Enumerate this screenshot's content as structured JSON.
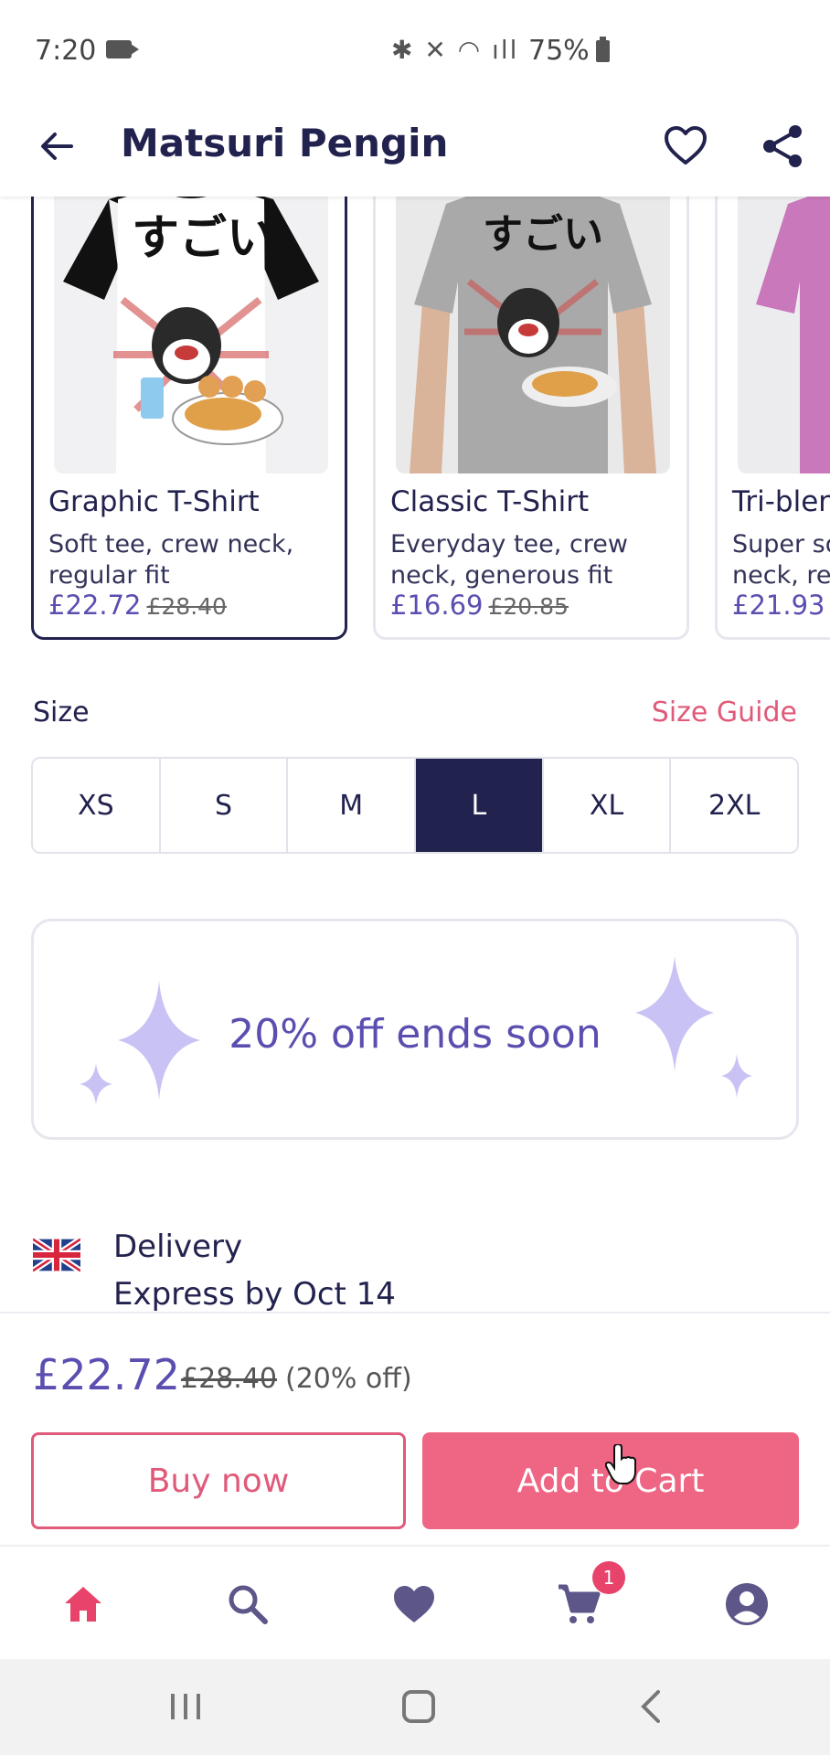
{
  "status_bar": {
    "time": "7:20",
    "icons": "✱ ✕ ◠ ıll",
    "battery": "75%"
  },
  "app_bar": {
    "title": "Matsuri Pengin"
  },
  "products": [
    {
      "title": "Graphic T-Shirt",
      "description": "Soft tee, crew neck, regular fit",
      "price": "£22.72",
      "old_price": "£28.40",
      "selected": true,
      "sleeve_color": "#111111",
      "body_color": "#ffffff"
    },
    {
      "title": "Classic T-Shirt",
      "description": "Everyday tee, crew neck, generous fit",
      "price": "£16.69",
      "old_price": "£20.85",
      "selected": false,
      "sleeve_color": "#9d9d9d",
      "body_color": "#a9a9a9"
    },
    {
      "title": "Tri-blend T-Shirt",
      "description": "Super soft tee, crew neck, regular fit",
      "price": "£21.93",
      "old_price": "",
      "selected": false,
      "sleeve_color": "#c874b8",
      "body_color": "#c978bb"
    }
  ],
  "size": {
    "label": "Size",
    "guide_label": "Size Guide",
    "options": [
      "XS",
      "S",
      "M",
      "L",
      "XL",
      "2XL"
    ],
    "selected": "L"
  },
  "promo": {
    "text": "20% off ends soon"
  },
  "delivery": {
    "title": "Delivery",
    "detail": "Express by Oct 14",
    "flag": "uk-flag-icon"
  },
  "purchase": {
    "price": "£22.72",
    "old_price": "£28.40",
    "discount": "(20% off)",
    "buy_now_label": "Buy now",
    "add_to_cart_label": "Add to Cart"
  },
  "bottom_nav": {
    "items": [
      "home-icon",
      "search-icon",
      "heart-icon",
      "cart-icon",
      "account-icon"
    ],
    "cart_count": "1"
  },
  "colors": {
    "brand_navy": "#22224f",
    "accent_pink": "#ef6584",
    "price_purple": "#5a4fb0",
    "sparkle": "#c9c2f5"
  }
}
